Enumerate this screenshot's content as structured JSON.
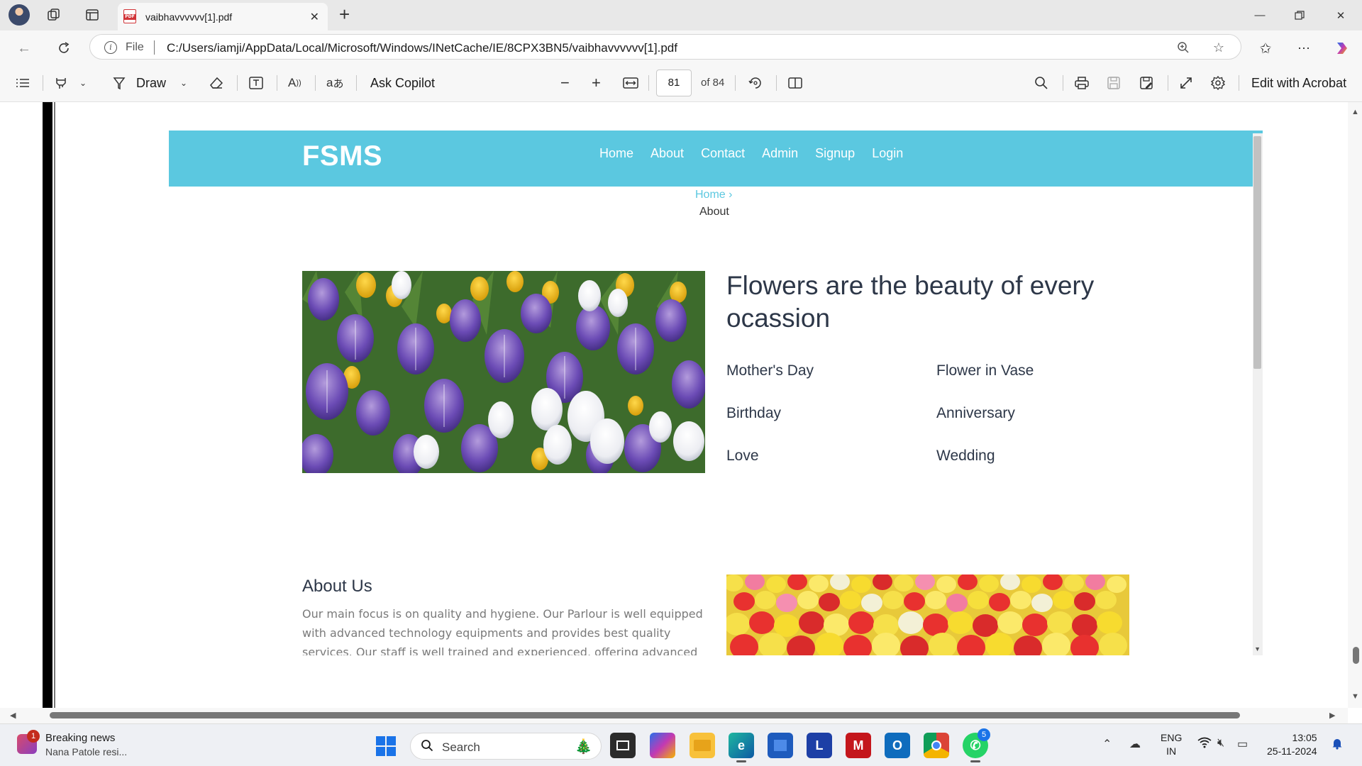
{
  "browser": {
    "tab_title": "vaibhavvvvvv[1].pdf",
    "url_scheme_label": "File",
    "url": "C:/Users/iamji/AppData/Local/Microsoft/Windows/INetCache/IE/8CPX3BN5/vaibhavvvvvv[1].pdf"
  },
  "pdf_toolbar": {
    "draw_label": "Draw",
    "ask_copilot_label": "Ask Copilot",
    "current_page": "81",
    "total_pages_label": "of 84",
    "edit_acrobat_label": "Edit with Acrobat"
  },
  "site": {
    "logo": "FSMS",
    "menu": [
      "Home",
      "About",
      "Contact",
      "Admin",
      "Signup",
      "Login"
    ],
    "breadcrumb_home": "Home ›",
    "breadcrumb_current": "About",
    "hero_title": "Flowers are the beauty of every ocassion",
    "occasions": [
      "Mother's Day",
      "Flower in Vase",
      "Birthday",
      "Anniversary",
      "Love",
      "Wedding"
    ],
    "about_title": "About Us",
    "about_text": "Our main focus is on quality and hygiene. Our Parlour is well equipped with advanced technology equipments and provides best quality services. Our staff is well trained and experienced, offering advanced services in"
  },
  "taskbar": {
    "news_badge": "1",
    "news_title": "Breaking news",
    "news_subtitle": "Nana Patole resi...",
    "search_label": "Search",
    "whatsapp_badge": "5",
    "lang_line1": "ENG",
    "lang_line2": "IN",
    "time": "13:05",
    "date": "25-11-2024"
  },
  "colors": {
    "site_nav": "#5bc8e0",
    "accent": "#0078d4"
  }
}
